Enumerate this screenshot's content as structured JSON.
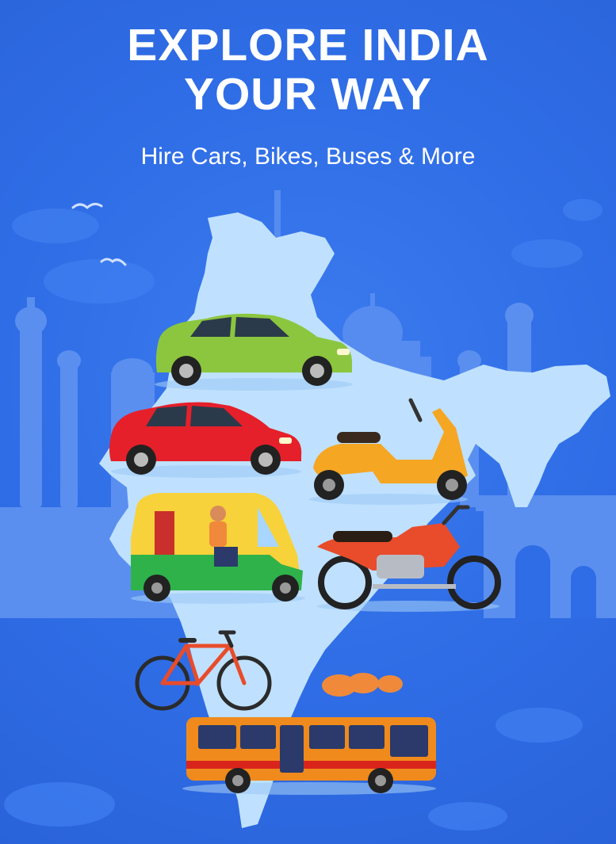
{
  "banner": {
    "headline_line1": "EXPLORE INDIA",
    "headline_line2": "YOUR WAY",
    "tagline": "Hire Cars, Bikes, Buses & More"
  },
  "illustration": {
    "map": "india-map",
    "vehicles": [
      "green-hatchback",
      "red-hatchback",
      "orange-scooter",
      "auto-rickshaw",
      "red-motorcycle",
      "bicycle",
      "bus"
    ],
    "landmarks": [
      "qutub-minar",
      "taj-mahal",
      "india-gate",
      "gateway-of-india"
    ]
  },
  "colors": {
    "background": "#2f6de6",
    "map": "#bfe1ff",
    "landmark_silhouette": "#5a8ff0",
    "green_car": "#8cc63f",
    "red_car": "#e5202a",
    "scooter": "#f5a623",
    "auto_green": "#2fb24a",
    "auto_yellow": "#f7d23a",
    "motorcycle": "#e84c2b",
    "bus_orange": "#f08a1c",
    "text": "#ffffff"
  }
}
